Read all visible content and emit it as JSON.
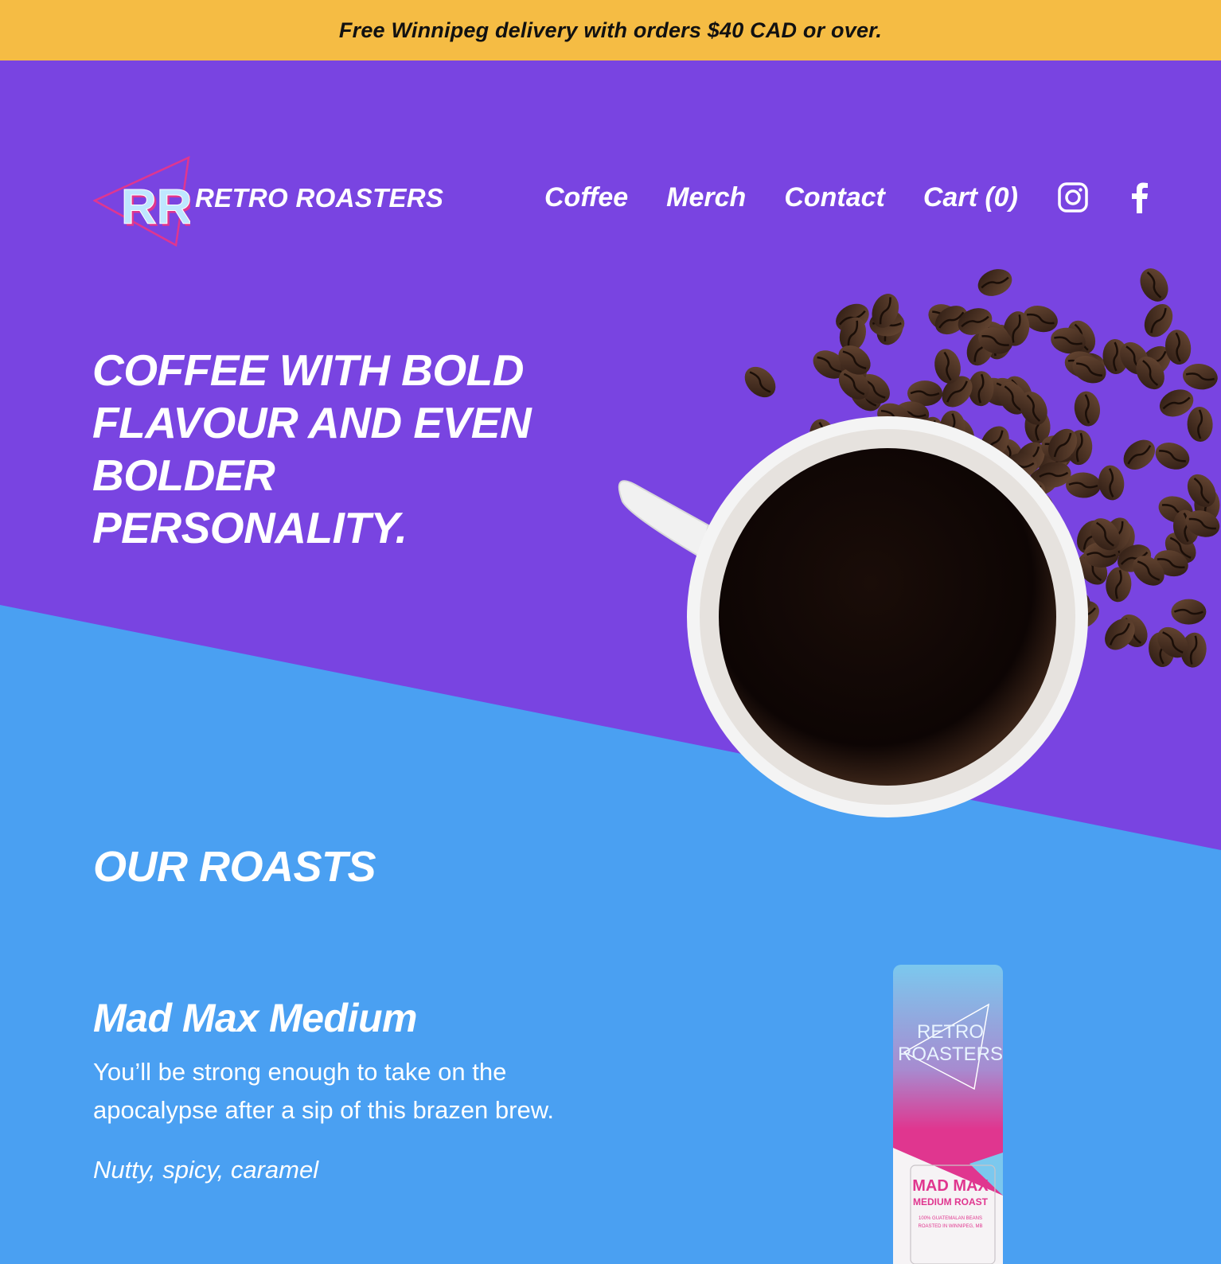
{
  "announcement": "Free Winnipeg delivery with orders $40 CAD or over.",
  "brand": {
    "name": "RETRO ROASTERS",
    "monogram": "RR"
  },
  "nav": {
    "coffee": "Coffee",
    "merch": "Merch",
    "contact": "Contact",
    "cart": "Cart (0)"
  },
  "social": [
    "instagram-icon",
    "facebook-icon"
  ],
  "hero": {
    "headline": "COFFEE WITH BOLD FLAVOUR AND EVEN BOLDER PERSONALITY."
  },
  "roasts": {
    "title": "OUR ROASTS",
    "items": [
      {
        "name": "Mad Max Medium",
        "description": "You’ll be strong enough to take on the apocalypse after a sip of this brazen brew.",
        "notes": "Nutty, spicy, caramel",
        "bag": {
          "brand_line1": "RETRO",
          "brand_line2": "ROASTERS",
          "product": "MAD MAX",
          "roast": "MEDIUM ROAST",
          "fine_print1": "100% GUATEMALAN BEANS",
          "fine_print2": "ROASTED IN WINNIPEG, MB"
        }
      }
    ]
  },
  "colors": {
    "announcement_bg": "#f5bc44",
    "hero_bg": "#7944e1",
    "section_bg": "#4aa0f2",
    "accent_pink": "#e0368f"
  }
}
